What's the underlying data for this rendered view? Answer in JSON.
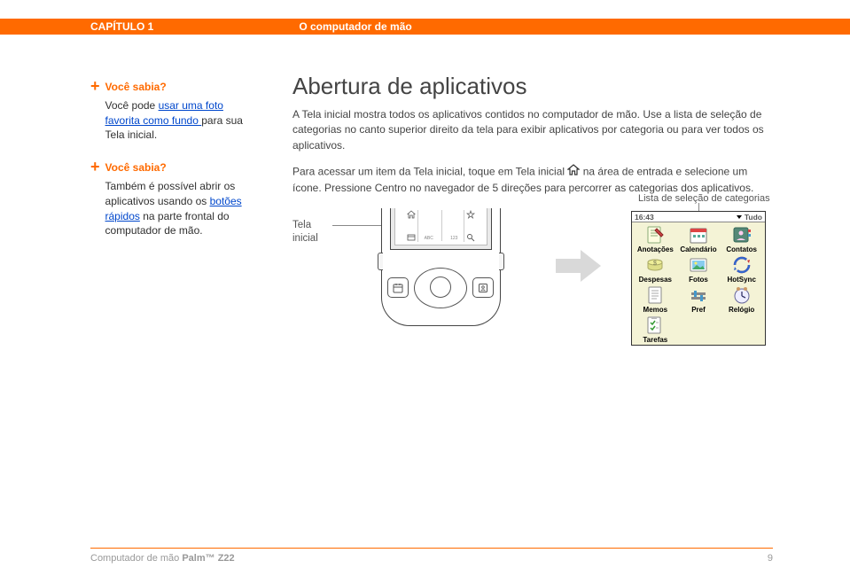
{
  "header": {
    "chapter": "CAPÍTULO 1",
    "title": "O computador de mão"
  },
  "sidebar": {
    "blocks": [
      {
        "heading": "Você sabia?",
        "pre": "Você pode ",
        "link": "usar uma foto favorita como fundo ",
        "post": "para sua Tela inicial."
      },
      {
        "heading": "Você sabia?",
        "pre": "Também é possível abrir os aplicativos usando os ",
        "link": "botões rápidos",
        "post": " na parte frontal do computador de mão."
      }
    ]
  },
  "main": {
    "heading": "Abertura de aplicativos",
    "para1": "A Tela inicial mostra todos os aplicativos contidos no computador de mão. Use a lista de seleção de categorias no canto superior direito da tela para exibir aplicativos por categoria ou para ver todos os aplicativos.",
    "para2a": "Para acessar um item da Tela inicial, toque em Tela inicial ",
    "para2b": " na área de entrada e selecione um ícone. Pressione Centro no navegador de 5 direções para percorrer as categorias dos aplicativos."
  },
  "captions": {
    "right": "Lista de seleção de categorias",
    "left": "Tela inicial"
  },
  "graffiti": {
    "abc": "ABC",
    "num": "123"
  },
  "palm": {
    "time": "16:43",
    "category": "Tudo",
    "apps": [
      {
        "label": "Anotações",
        "icon": "note"
      },
      {
        "label": "Calendário",
        "icon": "calendar"
      },
      {
        "label": "Contatos",
        "icon": "contacts"
      },
      {
        "label": "Despesas",
        "icon": "expenses"
      },
      {
        "label": "Fotos",
        "icon": "photos"
      },
      {
        "label": "HotSync",
        "icon": "hotsync"
      },
      {
        "label": "Memos",
        "icon": "memos"
      },
      {
        "label": "Pref",
        "icon": "pref"
      },
      {
        "label": "Relógio",
        "icon": "clock"
      },
      {
        "label": "Tarefas",
        "icon": "tasks"
      }
    ]
  },
  "footer": {
    "left_a": "Computador de mão ",
    "left_b": "Palm™ Z22",
    "page": "9"
  }
}
